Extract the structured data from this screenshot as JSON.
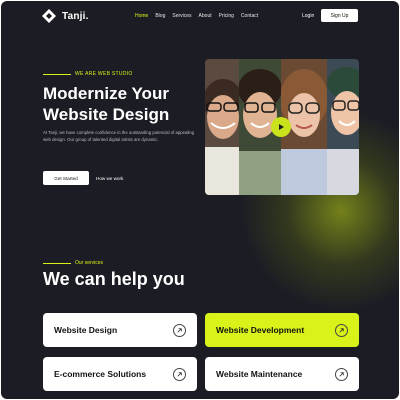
{
  "brand": {
    "name": "Tanji."
  },
  "nav": {
    "items": [
      "Home",
      "Blog",
      "Services",
      "About",
      "Pricing",
      "Contact"
    ],
    "active_index": 0,
    "login": "Login",
    "signup": "Sign Up"
  },
  "hero": {
    "eyebrow": "WE ARE WEB STUDIO",
    "title_line1": "Modernize Your",
    "title_line2": "Website Design",
    "description": "At Tanji, we have complete confidence in the outstanding potencial of appealing web design. Our group of talented digital artists are dynamic.",
    "cta_primary": "Get Started",
    "cta_secondary": "How we work"
  },
  "services": {
    "eyebrow": "Our services",
    "title": "We can help you",
    "cards": [
      {
        "label": "Website Design",
        "highlighted": false
      },
      {
        "label": "Website Development",
        "highlighted": true
      },
      {
        "label": "E-commerce Solutions",
        "highlighted": false
      },
      {
        "label": "Website Maintenance",
        "highlighted": false
      }
    ]
  },
  "colors": {
    "background": "#1c1d24",
    "accent": "#d8f21a",
    "card": "#ffffff"
  },
  "icons": [
    "logo-diamond-icon",
    "play-icon",
    "arrow-up-right-icon"
  ]
}
